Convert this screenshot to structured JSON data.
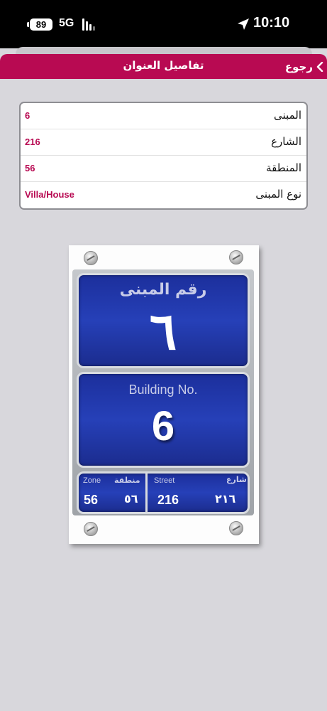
{
  "status_bar": {
    "battery": "89",
    "network": "5G",
    "time": "10:10"
  },
  "header": {
    "title": "تفاصيل العنوان",
    "back_label": "رجوع"
  },
  "details": [
    {
      "label": "المبنى",
      "value": "6"
    },
    {
      "label": "الشارع",
      "value": "216"
    },
    {
      "label": "المنطقة",
      "value": "56"
    },
    {
      "label": "نوع المبنى",
      "value": "Villa/House"
    }
  ],
  "plate": {
    "building_label_ar": "رقم المبنى",
    "building_number_ar": "٦",
    "building_label_en": "Building No.",
    "building_number_en": "6",
    "zone_label_en": "Zone",
    "zone_label_ar": "منطقة",
    "zone_number_en": "56",
    "zone_number_ar": "٥٦",
    "street_label_en": "Street",
    "street_label_ar": "شارع",
    "street_number_en": "216",
    "street_number_ar": "٢١٦"
  },
  "colors": {
    "accent": "#b80a52",
    "plate_blue": "#2640b8",
    "background": "#d8d7dc"
  }
}
